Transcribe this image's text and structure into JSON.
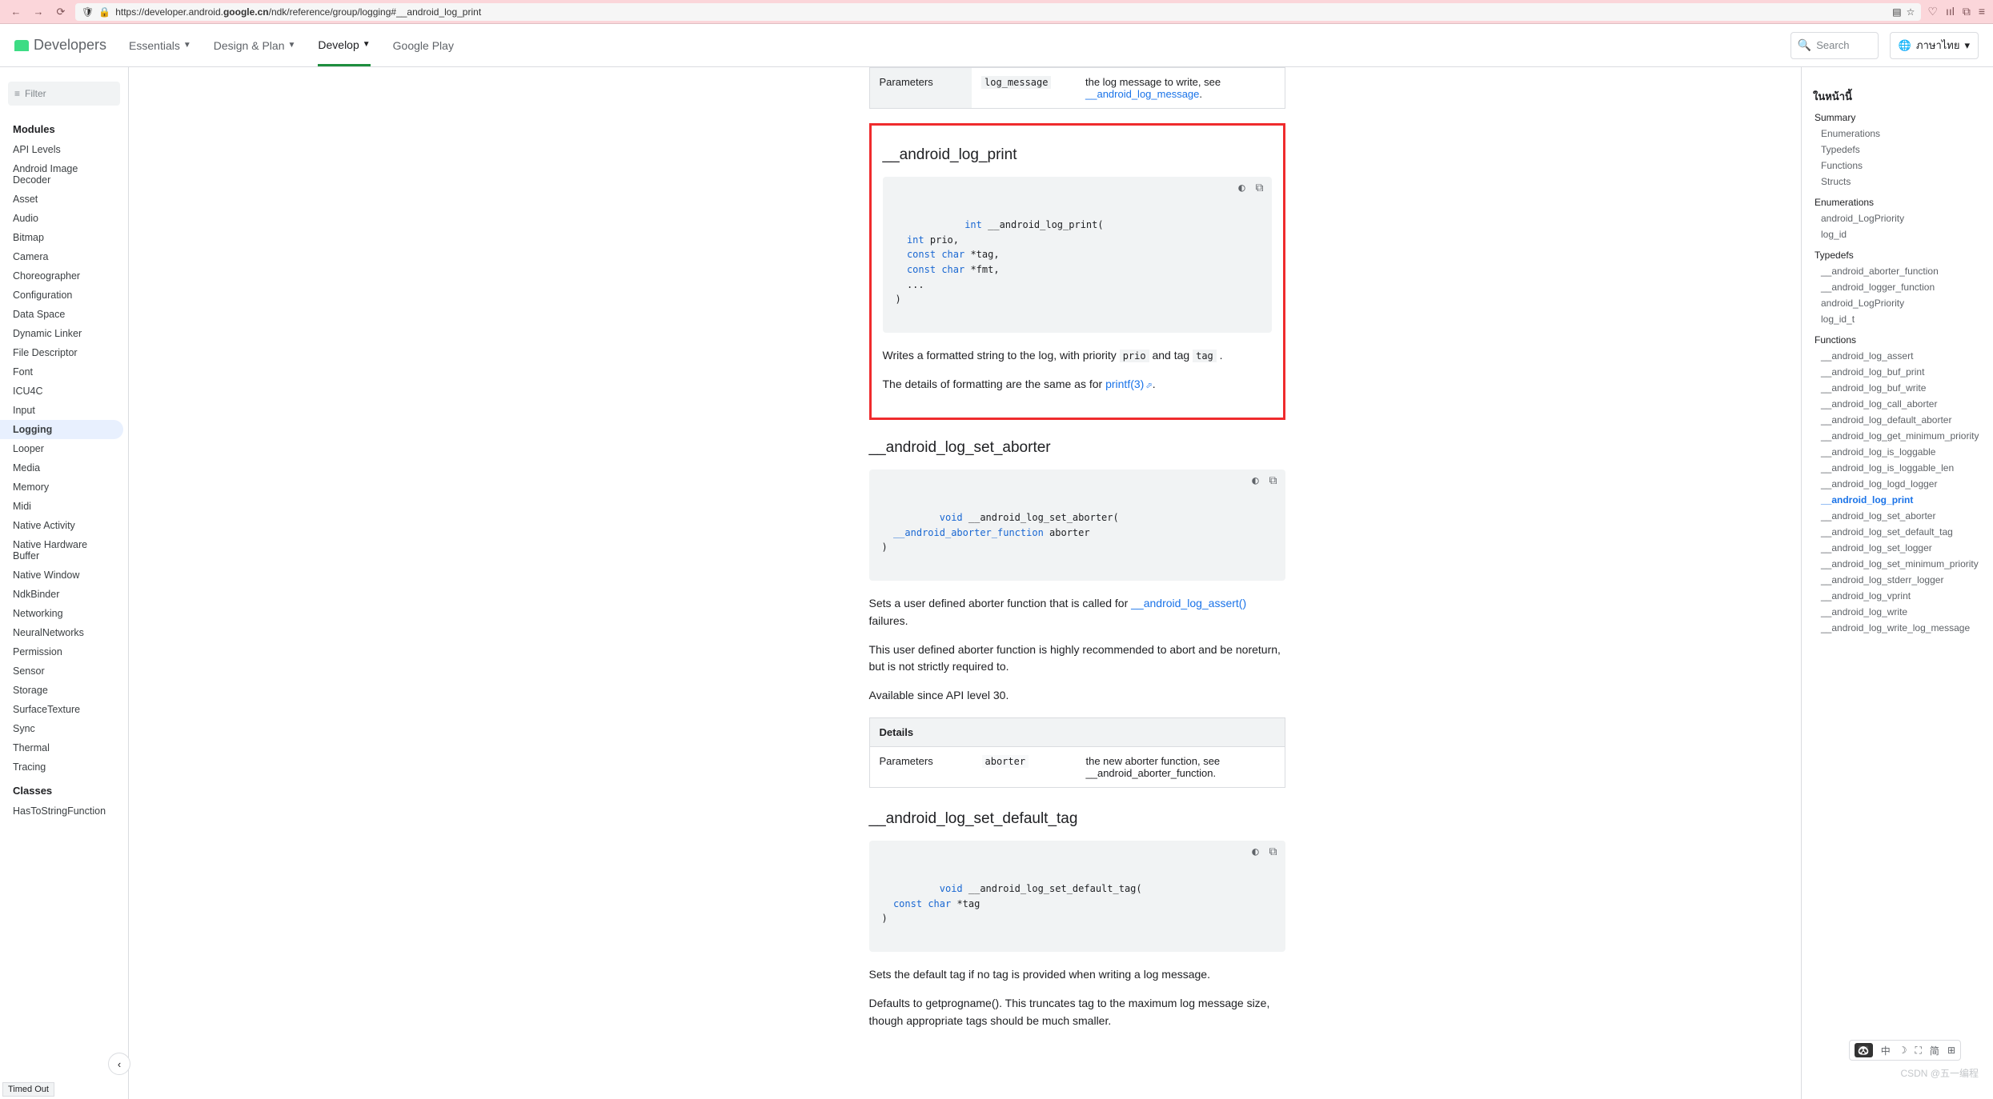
{
  "browser": {
    "url_prefix": "https://developer.android.",
    "url_domain": "google.cn",
    "url_suffix": "/ndk/reference/group/logging#__android_log_print",
    "timed_out": "Timed Out"
  },
  "header": {
    "logo_text": "Developers",
    "nav": [
      "Essentials",
      "Design & Plan",
      "Develop",
      "Google Play"
    ],
    "nav_active_index": 2,
    "search_placeholder": "Search",
    "language": "ภาษาไทย"
  },
  "sidebar": {
    "filter_placeholder": "Filter",
    "modules_label": "Modules",
    "modules": [
      "API Levels",
      "Android Image Decoder",
      "Asset",
      "Audio",
      "Bitmap",
      "Camera",
      "Choreographer",
      "Configuration",
      "Data Space",
      "Dynamic Linker",
      "File Descriptor",
      "Font",
      "ICU4C",
      "Input",
      "Logging",
      "Looper",
      "Media",
      "Memory",
      "Midi",
      "Native Activity",
      "Native Hardware Buffer",
      "Native Window",
      "NdkBinder",
      "Networking",
      "NeuralNetworks",
      "Permission",
      "Sensor",
      "Storage",
      "SurfaceTexture",
      "Sync",
      "Thermal",
      "Tracing"
    ],
    "modules_selected": "Logging",
    "classes_label": "Classes",
    "classes": [
      "HasToStringFunction"
    ]
  },
  "content": {
    "top_table": {
      "label": "Parameters",
      "param": "log_message",
      "desc_prefix": "the log message to write, see ",
      "desc_link": "__android_log_message",
      "desc_suffix": "."
    },
    "fn_print": {
      "title": "__android_log_print",
      "code_tokens": [
        {
          "t": "int",
          "c": "kw"
        },
        {
          "t": " __android_log_print(\n  "
        },
        {
          "t": "int",
          "c": "kw"
        },
        {
          "t": " prio,\n  "
        },
        {
          "t": "const",
          "c": "kw"
        },
        {
          "t": " "
        },
        {
          "t": "char",
          "c": "kw"
        },
        {
          "t": " *tag,\n  "
        },
        {
          "t": "const",
          "c": "kw"
        },
        {
          "t": " "
        },
        {
          "t": "char",
          "c": "kw"
        },
        {
          "t": " *fmt,\n  ...\n)"
        }
      ],
      "p1_before": "Writes a formatted string to the log, with priority ",
      "p1_code1": "prio",
      "p1_mid": " and tag ",
      "p1_code2": "tag",
      "p1_after": " .",
      "p2_before": "The details of formatting are the same as for ",
      "p2_link": "printf(3)",
      "p2_after": "."
    },
    "fn_set_aborter": {
      "title": "__android_log_set_aborter",
      "code_tokens": [
        {
          "t": "void",
          "c": "kw"
        },
        {
          "t": " __android_log_set_aborter(\n  "
        },
        {
          "t": "__android_aborter_function",
          "c": "kw"
        },
        {
          "t": " aborter\n)"
        }
      ],
      "p1_before": "Sets a user defined aborter function that is called for ",
      "p1_link": "__android_log_assert()",
      "p1_after": " failures.",
      "p2": "This user defined aborter function is highly recommended to abort and be noreturn, but is not strictly required to.",
      "p3": "Available since API level 30.",
      "details_label": "Details",
      "details_param_label": "Parameters",
      "details_param": "aborter",
      "details_desc": "the new aborter function, see __android_aborter_function."
    },
    "fn_set_default_tag": {
      "title": "__android_log_set_default_tag",
      "code_tokens": [
        {
          "t": "void",
          "c": "kw"
        },
        {
          "t": " __android_log_set_default_tag(\n  "
        },
        {
          "t": "const",
          "c": "kw"
        },
        {
          "t": " "
        },
        {
          "t": "char",
          "c": "kw"
        },
        {
          "t": " *tag\n)"
        }
      ],
      "p1": "Sets the default tag if no tag is provided when writing a log message.",
      "p2": "Defaults to getprogname(). This truncates tag to the maximum log message size, though appropriate tags should be much smaller."
    }
  },
  "toc": {
    "title": "ในหน้านี้",
    "sections": [
      {
        "label": "Summary",
        "children": [
          "Enumerations",
          "Typedefs",
          "Functions",
          "Structs"
        ]
      },
      {
        "label": "Enumerations",
        "children": [
          "android_LogPriority",
          "log_id"
        ]
      },
      {
        "label": "Typedefs",
        "children": [
          "__android_aborter_function",
          "__android_logger_function",
          "android_LogPriority",
          "log_id_t"
        ]
      },
      {
        "label": "Functions",
        "children": [
          "__android_log_assert",
          "__android_log_buf_print",
          "__android_log_buf_write",
          "__android_log_call_aborter",
          "__android_log_default_aborter",
          "__android_log_get_minimum_priority",
          "__android_log_is_loggable",
          "__android_log_is_loggable_len",
          "__android_log_logd_logger",
          "__android_log_print",
          "__android_log_set_aborter",
          "__android_log_set_default_tag",
          "__android_log_set_logger",
          "__android_log_set_minimum_priority",
          "__android_log_stderr_logger",
          "__android_log_vprint",
          "__android_log_write",
          "__android_log_write_log_message"
        ]
      }
    ],
    "active": "__android_log_print"
  },
  "watermark": "CSDN @五一编程",
  "float_tools": [
    "中",
    "简"
  ]
}
